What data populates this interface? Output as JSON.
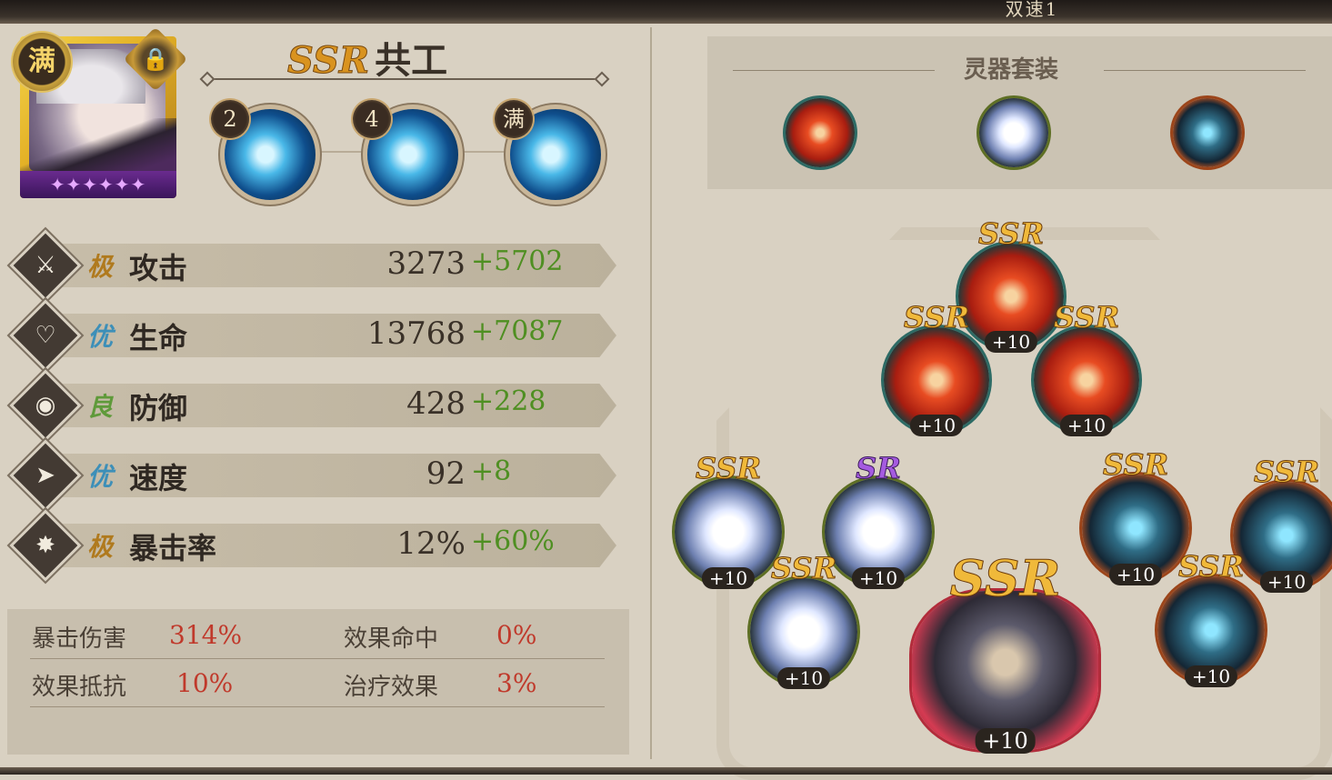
{
  "header": {
    "title": "双速1"
  },
  "shikigami": {
    "rarity": "SSR",
    "name": "共工",
    "full_badge": "满",
    "stars_count": 6,
    "skills": [
      {
        "level": "2",
        "icon": "water-bubble-skill-icon"
      },
      {
        "level": "4",
        "icon": "whirlpool-figure-skill-icon"
      },
      {
        "level": "满",
        "icon": "water-orbs-skill-icon"
      }
    ]
  },
  "stats": [
    {
      "icon": "attack-icon",
      "grade": "极",
      "grade_color": "#b07a1e",
      "label": "攻击",
      "base": "3273",
      "bonus": "+5702"
    },
    {
      "icon": "health-icon",
      "grade": "优",
      "grade_color": "#3d8fb8",
      "label": "生命",
      "base": "13768",
      "bonus": "+7087"
    },
    {
      "icon": "defense-icon",
      "grade": "良",
      "grade_color": "#5f9a3a",
      "label": "防御",
      "base": "428",
      "bonus": "+228"
    },
    {
      "icon": "speed-icon",
      "grade": "优",
      "grade_color": "#3d8fb8",
      "label": "速度",
      "base": "92",
      "bonus": "+8"
    },
    {
      "icon": "crit-rate-icon",
      "grade": "极",
      "grade_color": "#b07a1e",
      "label": "暴击率",
      "base": "12%",
      "bonus": "+60%"
    }
  ],
  "secondary_stats": [
    {
      "label": "暴击伤害",
      "value": "314%"
    },
    {
      "label": "效果命中",
      "value": "0%"
    },
    {
      "label": "效果抵抗",
      "value": "10%"
    },
    {
      "label": "治疗效果",
      "value": "3%"
    }
  ],
  "soul_sets": {
    "title": "灵器套装",
    "sets": [
      "fire-eye-set-icon",
      "white-flower-set-icon",
      "blue-swirl-set-icon"
    ]
  },
  "equipment": [
    {
      "rarity": "SSR",
      "level": "+10",
      "type": "red"
    },
    {
      "rarity": "SSR",
      "level": "+10",
      "type": "red"
    },
    {
      "rarity": "SSR",
      "level": "+10",
      "type": "red"
    },
    {
      "rarity": "SSR",
      "level": "+10",
      "type": "flower"
    },
    {
      "rarity": "SR",
      "level": "+10",
      "type": "flower"
    },
    {
      "rarity": "SSR",
      "level": "+10",
      "type": "flower"
    },
    {
      "rarity": "SSR",
      "level": "+10",
      "type": "blue"
    },
    {
      "rarity": "SSR",
      "level": "+10",
      "type": "blue"
    },
    {
      "rarity": "SSR",
      "level": "+10",
      "type": "blue"
    },
    {
      "rarity": "SSR",
      "level": "+10",
      "type": "main"
    }
  ],
  "colors": {
    "ssr_gold": "#f0b93a",
    "sr_purple": "#a55be0",
    "bonus_green": "#4f8f22",
    "value_red": "#c0392b"
  }
}
